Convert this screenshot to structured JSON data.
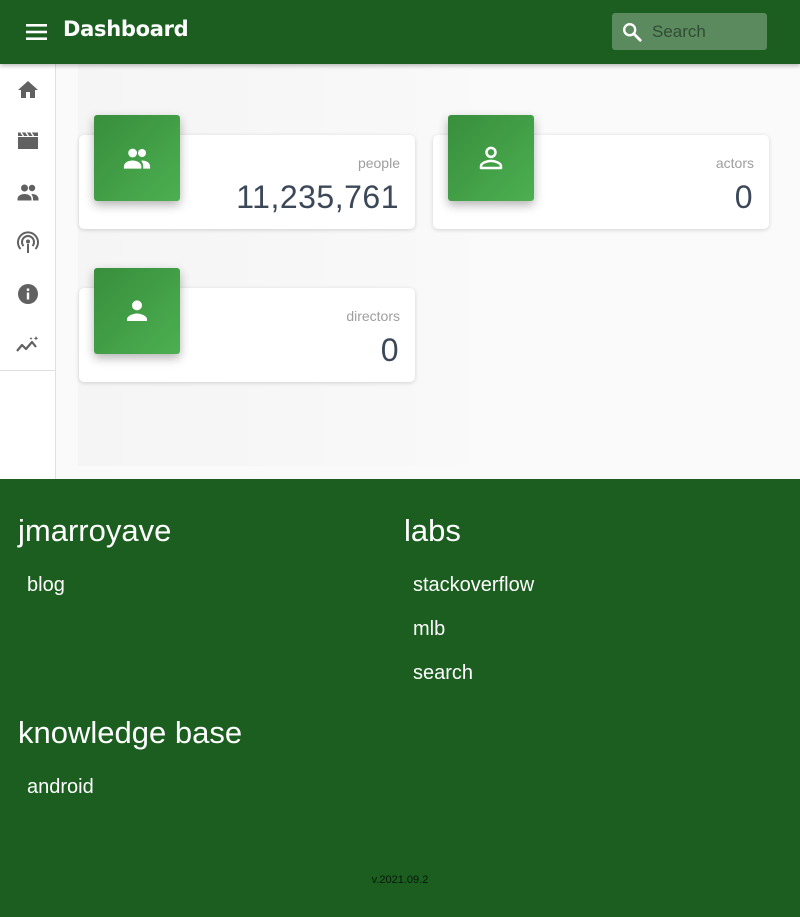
{
  "appbar": {
    "title": "Dashboard",
    "search_placeholder": "Search",
    "menu_icon": "menu-icon",
    "search_icon": "search-icon"
  },
  "sidebar": {
    "items": [
      {
        "icon": "home-icon"
      },
      {
        "icon": "movie-icon"
      },
      {
        "icon": "people-icon"
      },
      {
        "icon": "podcast-icon"
      },
      {
        "icon": "info-icon"
      },
      {
        "icon": "trending-icon"
      }
    ]
  },
  "cards": [
    {
      "label": "people",
      "value": "11,235,761",
      "icon": "people-icon"
    },
    {
      "label": "actors",
      "value": "0",
      "icon": "person-outline-icon"
    },
    {
      "label": "directors",
      "value": "0",
      "icon": "person-icon"
    }
  ],
  "footer": {
    "sections": [
      {
        "heading": "jmarroyave",
        "links": [
          "blog"
        ]
      },
      {
        "heading": "labs",
        "links": [
          "stackoverflow",
          "mlb",
          "search"
        ]
      },
      {
        "heading": "knowledge base",
        "links": [
          "android"
        ]
      }
    ],
    "version": "v.2021.09.2"
  },
  "colors": {
    "primary": "#1b5e20",
    "accent": "#43a047",
    "icon_gray": "#616161"
  }
}
